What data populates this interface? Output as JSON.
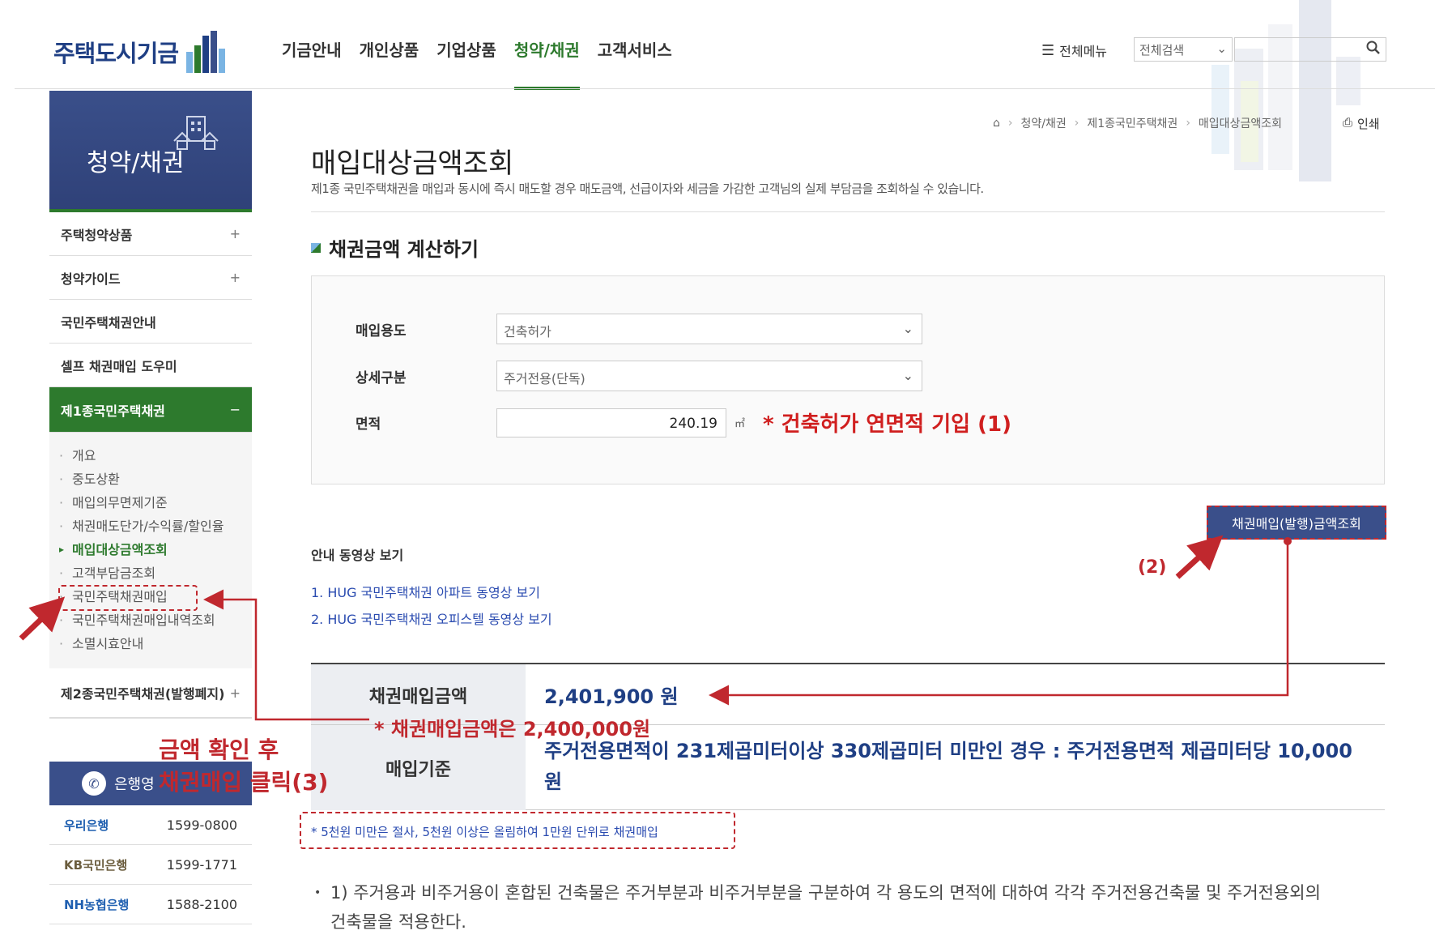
{
  "header": {
    "logo_text": "주택도시기금",
    "nav": [
      "기금안내",
      "개인상품",
      "기업상품",
      "청약/채권",
      "고객서비스"
    ],
    "nav_active_index": 3,
    "all_menu": "전체메뉴",
    "search_scope": "전체검색",
    "search_placeholder": ""
  },
  "sidebar": {
    "banner_title": "청약/채권",
    "items": [
      {
        "label": "주택청약상품",
        "toggle": "+"
      },
      {
        "label": "청약가이드",
        "toggle": "+"
      },
      {
        "label": "국민주택채권안내",
        "toggle": ""
      },
      {
        "label": "셀프 채권매입 도우미",
        "toggle": ""
      },
      {
        "label": "제1종국민주택채권",
        "toggle": "−"
      }
    ],
    "sub_items": [
      "개요",
      "중도상환",
      "매입의무면제기준",
      "채권매도단가/수익률/할인율",
      "매입대상금액조회",
      "고객부담금조회",
      "국민주택채권매입",
      "국민주택채권매입내역조회",
      "소멸시효안내"
    ],
    "last_item": {
      "label": "제2종국민주택채권(발행폐지)",
      "toggle": "+"
    },
    "bank_head": "은행영",
    "banks": [
      {
        "name": "우리은행",
        "phone": "1599-0800"
      },
      {
        "name": "KB국민은행",
        "phone": "1599-1771"
      },
      {
        "name": "NH농협은행",
        "phone": "1588-2100"
      }
    ]
  },
  "breadcrumb": [
    "청약/채권",
    "제1종국민주택채권",
    "매입대상금액조회"
  ],
  "print_label": "인쇄",
  "page": {
    "title": "매입대상금액조회",
    "description": "제1종 국민주택채권을 매입과 동시에 즉시 매도할 경우 매도금액, 선급이자와 세금을 가감한 고객님의 실제 부담금을 조회하실 수 있습니다.",
    "section_title": "채권금액 계산하기"
  },
  "form": {
    "purpose_label": "매입용도",
    "purpose_value": "건축허가",
    "detail_label": "상세구분",
    "detail_value": "주거전용(단독)",
    "area_label": "면적",
    "area_value": "240.19",
    "area_unit": "㎡",
    "annotation_1": "* 건축허가 연면적 기입 (1)"
  },
  "query_button": "채권매입(발행)금액조회",
  "annotation_2": "(2)",
  "video": {
    "title": "안내 동영상 보기",
    "links": [
      "1. HUG 국민주택채권 아파트 동영상 보기",
      "2. HUG 국민주택채권 오피스텔 동영상 보기"
    ]
  },
  "result": {
    "amount_label": "채권매입금액",
    "amount_value": "2,401,900 원",
    "basis_label": "매입기준",
    "basis_value": "주거전용면적이 231제곱미터이상 330제곱미터 미만인 경우 : 주거전용면적 제곱미터당 10,000원",
    "annotation_3": "* 채권매입금액은 2,400,000원"
  },
  "note": "* 5천원 미만은 절사, 5천원 이상은 올림하여 1만원 단위로 채권매입",
  "footnote": "1) 주거용과 비주거용이 혼합된 건축물은 주거부분과 비주거부분을 구분하여 각 용도의 면적에 대하여 각각 주거전용건축물 및 주거전용외의 건축물을 적용한다.",
  "annotation_4_line1": "금액 확인 후",
  "annotation_4_line2": "채권매입 클릭(3)",
  "colors": {
    "accent_green": "#2d7a2d",
    "navy": "#3a4f8a",
    "annotation_red": "#c0282e"
  }
}
